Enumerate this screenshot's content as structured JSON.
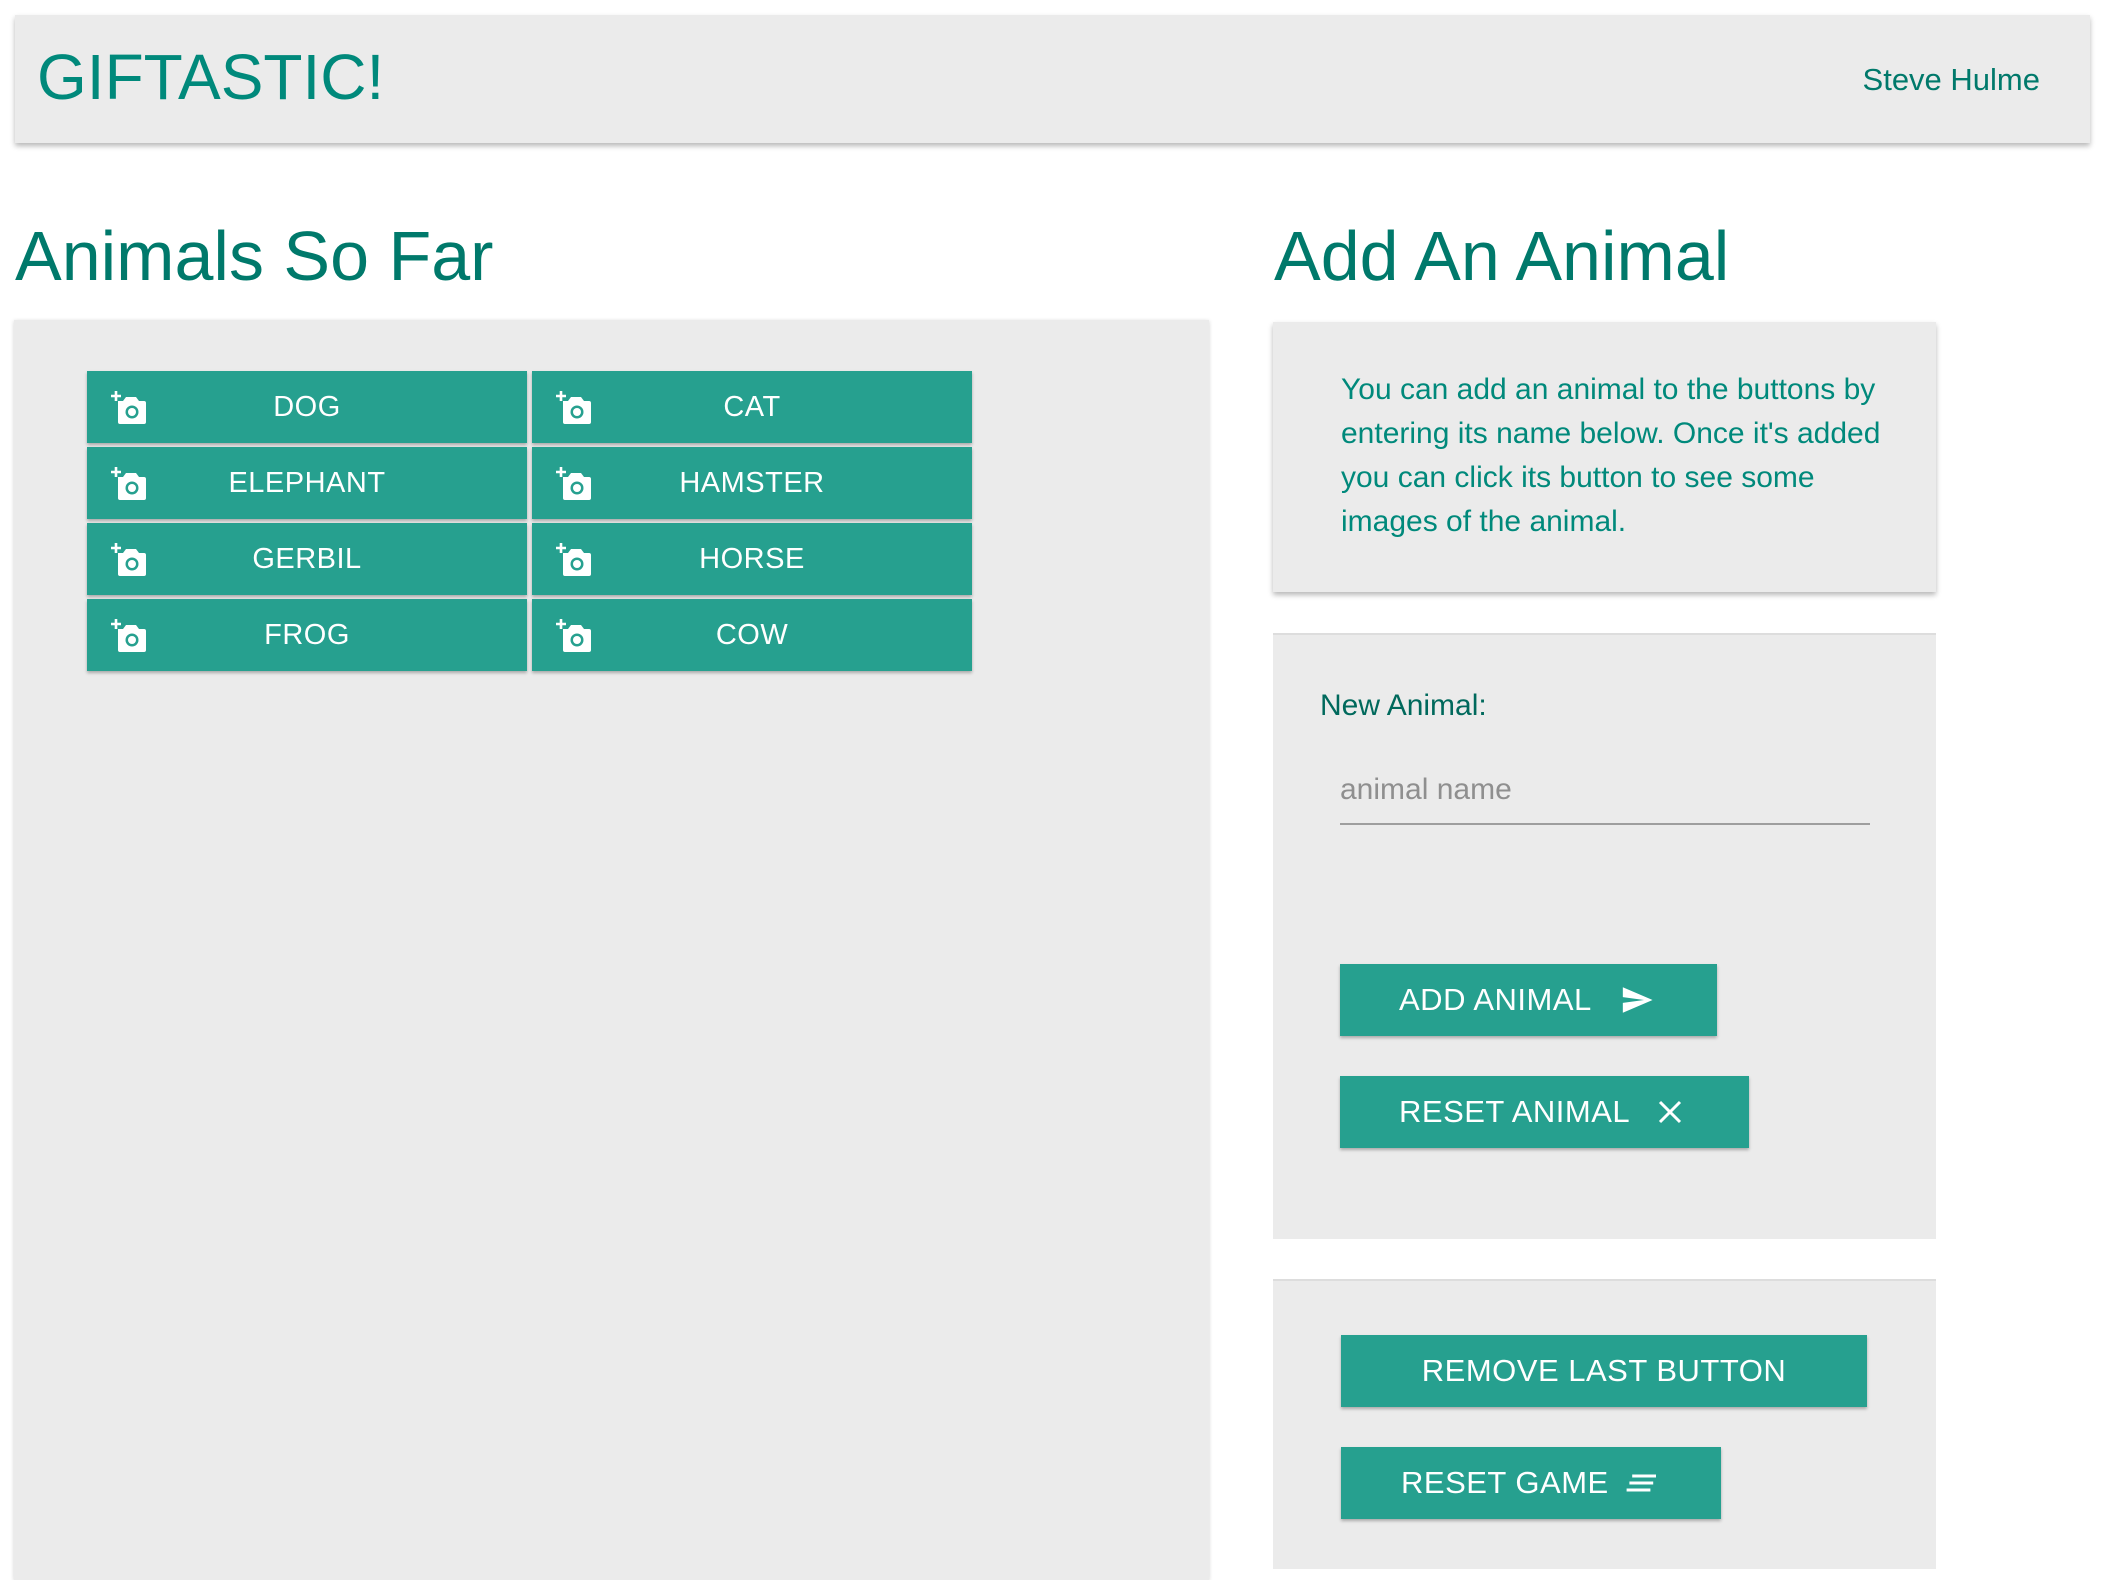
{
  "header": {
    "brand": "GIFTASTIC!",
    "user": "Steve Hulme"
  },
  "animals_panel": {
    "title": "Animals So Far",
    "buttons": [
      {
        "label": "DOG",
        "icon": "add-a-photo-icon"
      },
      {
        "label": "CAT",
        "icon": "add-a-photo-icon"
      },
      {
        "label": "ELEPHANT",
        "icon": "add-a-photo-icon"
      },
      {
        "label": "HAMSTER",
        "icon": "add-a-photo-icon"
      },
      {
        "label": "GERBIL",
        "icon": "add-a-photo-icon"
      },
      {
        "label": "HORSE",
        "icon": "add-a-photo-icon"
      },
      {
        "label": "FROG",
        "icon": "add-a-photo-icon"
      },
      {
        "label": "COW",
        "icon": "add-a-photo-icon"
      }
    ]
  },
  "add_panel": {
    "title": "Add An Animal",
    "info": "You can add an animal to the buttons by entering its name below. Once it's added you can click its button to see some images of the animal.",
    "form": {
      "label": "New Animal:",
      "input_value": "",
      "placeholder": "animal name",
      "add_label": "ADD ANIMAL",
      "add_icon": "send-icon",
      "reset_label": "RESET ANIMAL",
      "reset_icon": "close-icon"
    },
    "controls": {
      "remove_last_label": "REMOVE LAST BUTTON",
      "reset_game_label": "RESET GAME",
      "reset_game_icon": "short-text-icon"
    }
  },
  "colors": {
    "accent": "#26a08f",
    "brand_text": "#00897b",
    "title_text": "#00796b",
    "panel_bg": "#ebebeb",
    "button_text": "#ffffff"
  }
}
